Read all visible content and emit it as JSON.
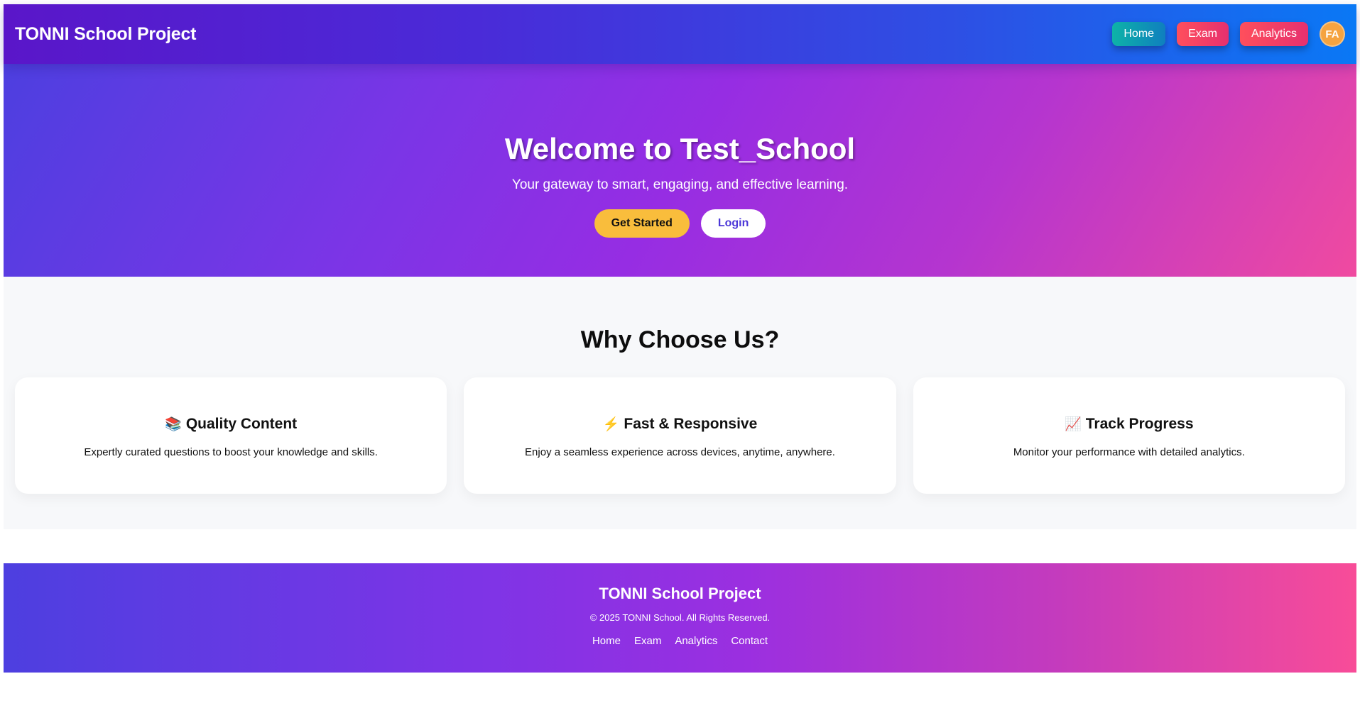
{
  "navbar": {
    "brand": "TONNI School Project",
    "links": {
      "home": "Home",
      "exam": "Exam",
      "analytics": "Analytics"
    },
    "avatar_initials": "FA"
  },
  "hero": {
    "title": "Welcome to Test_School",
    "subtitle": "Your gateway to smart, engaging, and effective learning.",
    "get_started_label": "Get Started",
    "login_label": "Login"
  },
  "features": {
    "title": "Why Choose Us?",
    "cards": [
      {
        "icon": "books-icon",
        "glyph": "📚",
        "title": "Quality Content",
        "description": "Expertly curated questions to boost your knowledge and skills."
      },
      {
        "icon": "lightning-icon",
        "glyph": "⚡",
        "title": "Fast & Responsive",
        "description": "Enjoy a seamless experience across devices, anytime, anywhere."
      },
      {
        "icon": "chart-increasing-icon",
        "glyph": "📈",
        "title": "Track Progress",
        "description": "Monitor your performance with detailed analytics."
      }
    ]
  },
  "footer": {
    "brand": "TONNI School Project",
    "copyright": "© 2025 TONNI School. All Rights Reserved.",
    "links": {
      "home": "Home",
      "exam": "Exam",
      "analytics": "Analytics",
      "contact": "Contact"
    }
  },
  "colors": {
    "accent_yellow": "#f9bd3c",
    "avatar_orange": "#f5a340",
    "home_button_teal": "#0eb3a7",
    "exam_button_red": "#ff4f5c",
    "login_text_indigo": "#4b37d8"
  }
}
